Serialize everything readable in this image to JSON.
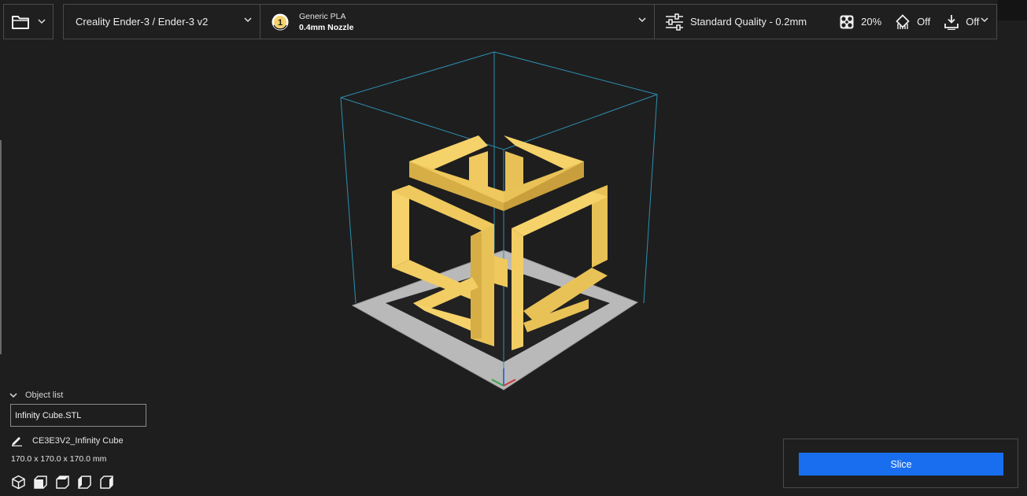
{
  "toolbar": {
    "open_icon": "folder-icon",
    "printer_name": "Creality Ender-3 / Ender-3 v2",
    "material": {
      "extruder_badge": "1",
      "name": "Generic PLA",
      "nozzle": "0.4mm Nozzle"
    },
    "print_settings": {
      "profile": "Standard Quality - 0.2mm",
      "infill": "20%",
      "support": "Off",
      "adhesion": "Off"
    }
  },
  "object_panel": {
    "header": "Object list",
    "items": [
      "Infinity Cube.STL"
    ],
    "object_name": "CE3E3V2_Infinity Cube",
    "dimensions": "170.0 x 170.0 x 170.0 mm",
    "view_icons": [
      "view-3d-icon",
      "view-front-icon",
      "view-top-icon",
      "view-left-icon",
      "view-right-icon"
    ]
  },
  "slice": {
    "label": "Slice"
  },
  "colors": {
    "accent": "#196ef0",
    "model": "#f5d26a",
    "build_plate": "#b8b8b8",
    "bounding_box": "#2d8fb0"
  }
}
